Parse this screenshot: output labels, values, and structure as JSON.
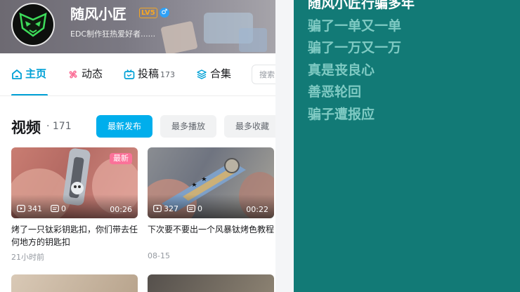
{
  "profile": {
    "name": "随风小匠",
    "level": "LV5",
    "gender_icon": "male-icon",
    "bio": "EDC制作狂热爱好者......"
  },
  "tabs": [
    {
      "label": "主页",
      "icon": "home-icon",
      "active": true
    },
    {
      "label": "动态",
      "icon": "pinwheel-icon"
    },
    {
      "label": "投稿",
      "icon": "tv-icon",
      "count": "173"
    },
    {
      "label": "合集",
      "icon": "layers-icon"
    }
  ],
  "search": {
    "placeholder": "搜索"
  },
  "videos": {
    "title": "视频",
    "count": "· 171",
    "sort_options": [
      "最新发布",
      "最多播放",
      "最多收藏"
    ],
    "items": [
      {
        "title": "烤了一只钛彩钥匙扣，你们带去任何地方的钥匙扣",
        "views": "341",
        "danmaku": "0",
        "duration": "00:26",
        "date": "21小时前",
        "badge": "最新"
      },
      {
        "title": "下次要不要出一个风暴钛烤色教程",
        "views": "327",
        "danmaku": "0",
        "duration": "00:22",
        "date": "08-15"
      }
    ]
  },
  "lyrics": [
    "随风小匠行骗多年",
    "骗了一单又一单",
    "骗了一万又一万",
    "真是丧良心",
    "善恶轮回",
    "骗子遭报应"
  ],
  "colors": {
    "accent": "#00aeec",
    "badge": "#fb7299",
    "background": "#127a76",
    "lyric": "#7fcac3"
  }
}
